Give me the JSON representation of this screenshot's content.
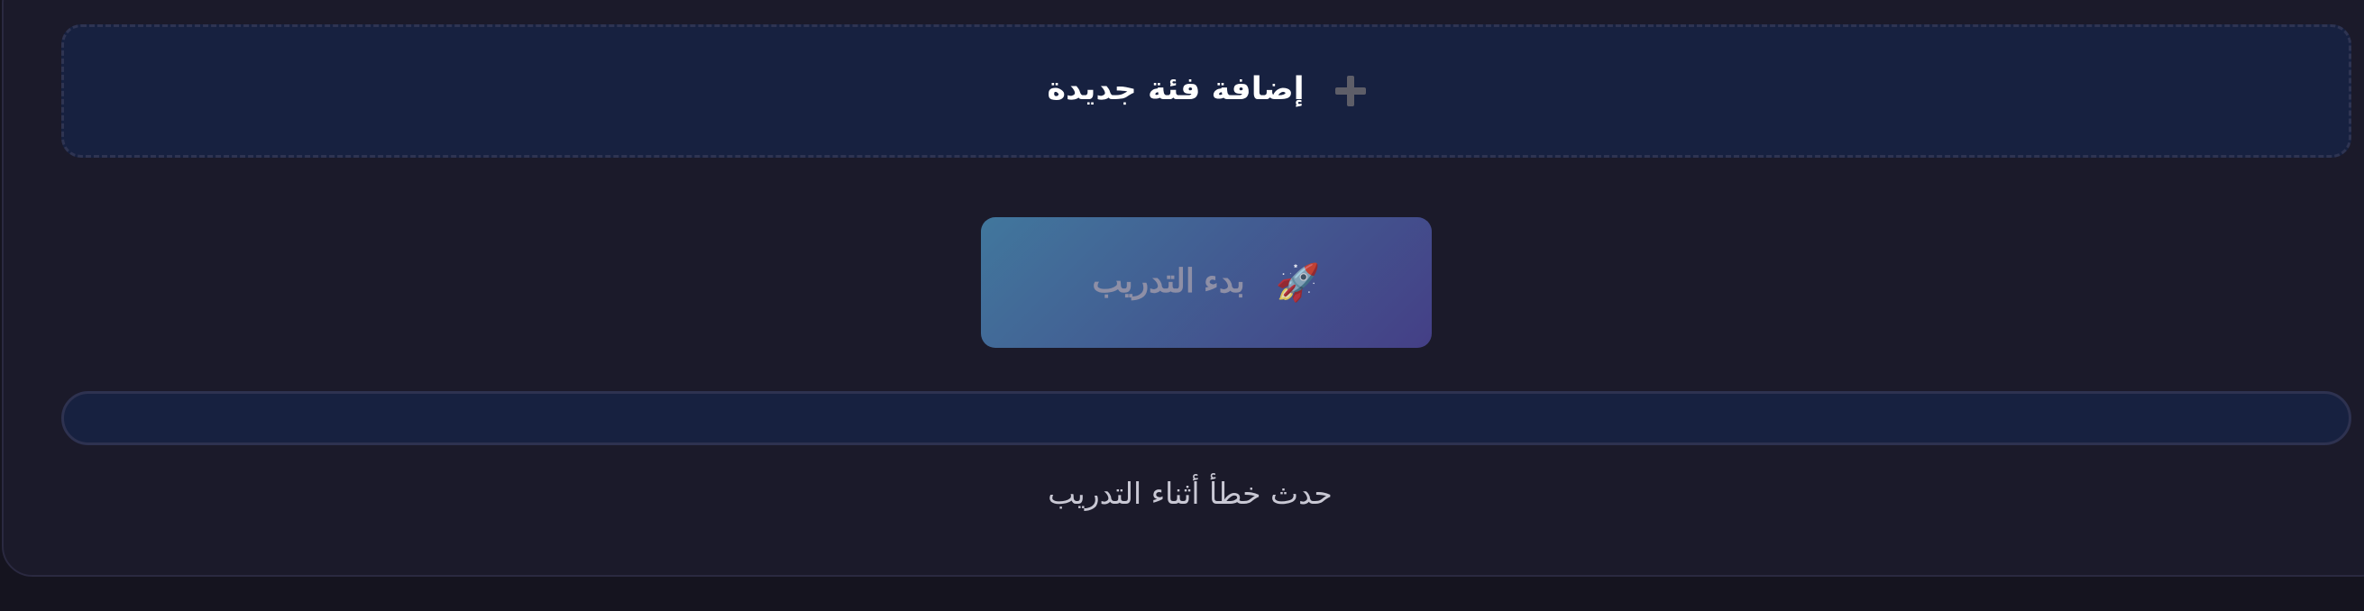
{
  "add_category": {
    "label": "إضافة فئة جديدة",
    "icon": "plus-icon"
  },
  "train_button": {
    "label": "بدء التدريب",
    "icon": "rocket-icon",
    "icon_glyph": "🚀"
  },
  "progress": {
    "value_percent": 0
  },
  "status": {
    "message": "حدث خطأ أثناء التدريب"
  },
  "colors": {
    "page_background": "#15141f",
    "panel_background": "#1b1a2a",
    "card_background": "#172140",
    "button_gradient_start": "#41779d",
    "button_gradient_end": "#443f86"
  }
}
